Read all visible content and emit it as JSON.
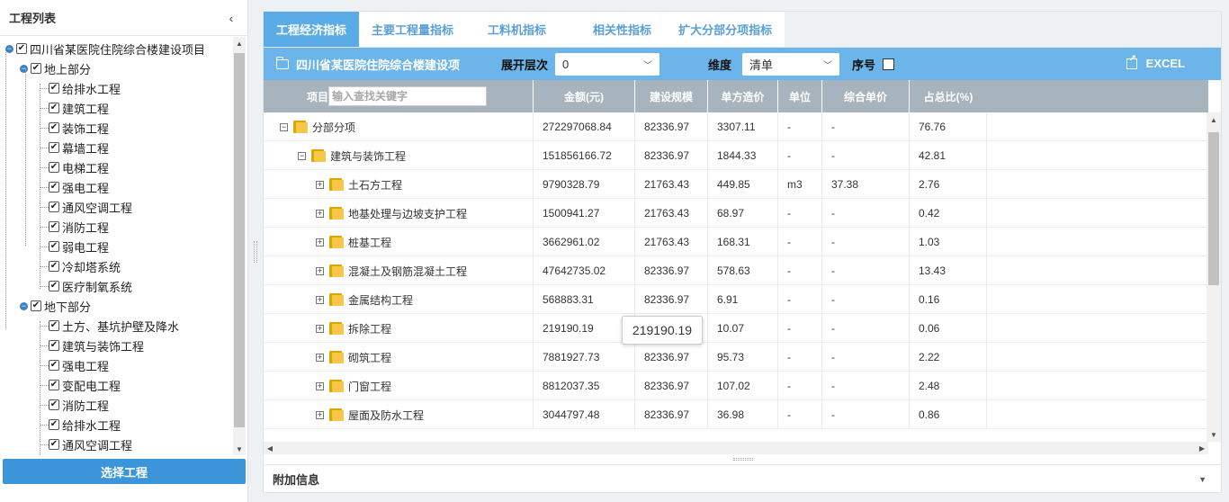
{
  "left": {
    "title": "工程列表",
    "select_button": "选择工程",
    "tree": [
      {
        "label": "四川省某医院住院综合楼建设项目",
        "level": 0,
        "toggle": "−"
      },
      {
        "label": "地上部分",
        "level": 1,
        "toggle": "−"
      },
      {
        "label": "给排水工程",
        "level": 2
      },
      {
        "label": "建筑工程",
        "level": 2
      },
      {
        "label": "装饰工程",
        "level": 2
      },
      {
        "label": "幕墙工程",
        "level": 2
      },
      {
        "label": "电梯工程",
        "level": 2
      },
      {
        "label": "强电工程",
        "level": 2
      },
      {
        "label": "通风空调工程",
        "level": 2
      },
      {
        "label": "消防工程",
        "level": 2
      },
      {
        "label": "弱电工程",
        "level": 2
      },
      {
        "label": "冷却塔系统",
        "level": 2
      },
      {
        "label": "医疗制氧系统",
        "level": 2
      },
      {
        "label": "地下部分",
        "level": 1,
        "toggle": "−"
      },
      {
        "label": "土方、基坑护壁及降水",
        "level": 2
      },
      {
        "label": "建筑与装饰工程",
        "level": 2
      },
      {
        "label": "强电工程",
        "level": 2
      },
      {
        "label": "变配电工程",
        "level": 2
      },
      {
        "label": "消防工程",
        "level": 2
      },
      {
        "label": "给排水工程",
        "level": 2
      },
      {
        "label": "通风空调工程",
        "level": 2
      }
    ]
  },
  "tabs": [
    {
      "label": "工程经济指标",
      "active": true
    },
    {
      "label": "主要工程量指标",
      "active": false
    },
    {
      "label": "工料机指标",
      "active": false
    },
    {
      "label": "相关性指标",
      "active": false
    },
    {
      "label": "扩大分部分项指标",
      "active": false
    }
  ],
  "toolbar": {
    "project_name": "四川省某医院住院综合楼建设项",
    "expand_label": "展开层次",
    "expand_value": "0",
    "dimension_label": "维度",
    "dimension_value": "清单",
    "index_label": "序号",
    "excel_label": "EXCEL"
  },
  "grid": {
    "columns": [
      "项目",
      "金额(元)",
      "建设规模",
      "单方造价",
      "单位",
      "综合单价",
      "占总比(%)"
    ],
    "search_placeholder": "输入查找关键字",
    "rows": [
      {
        "name": "分部分项",
        "depth": 0,
        "toggle": "−",
        "amount": "272297068.84",
        "scale": "82336.97",
        "unit_cost": "3307.11",
        "unit": "-",
        "comp_price": "-",
        "ratio": "76.76"
      },
      {
        "name": "建筑与装饰工程",
        "depth": 1,
        "toggle": "−",
        "amount": "151856166.72",
        "scale": "82336.97",
        "unit_cost": "1844.33",
        "unit": "-",
        "comp_price": "-",
        "ratio": "42.81"
      },
      {
        "name": "土石方工程",
        "depth": 2,
        "toggle": "+",
        "amount": "9790328.79",
        "scale": "21763.43",
        "unit_cost": "449.85",
        "unit": "m3",
        "comp_price": "37.38",
        "ratio": "2.76"
      },
      {
        "name": "地基处理与边坡支护工程",
        "depth": 2,
        "toggle": "+",
        "amount": "1500941.27",
        "scale": "21763.43",
        "unit_cost": "68.97",
        "unit": "-",
        "comp_price": "-",
        "ratio": "0.42"
      },
      {
        "name": "桩基工程",
        "depth": 2,
        "toggle": "+",
        "amount": "3662961.02",
        "scale": "21763.43",
        "unit_cost": "168.31",
        "unit": "-",
        "comp_price": "-",
        "ratio": "1.03"
      },
      {
        "name": "混凝土及钢筋混凝土工程",
        "depth": 2,
        "toggle": "+",
        "amount": "47642735.02",
        "scale": "82336.97",
        "unit_cost": "578.63",
        "unit": "-",
        "comp_price": "-",
        "ratio": "13.43"
      },
      {
        "name": "金属结构工程",
        "depth": 2,
        "toggle": "+",
        "amount": "568883.31",
        "scale": "82336.97",
        "unit_cost": "6.91",
        "unit": "-",
        "comp_price": "-",
        "ratio": "0.16"
      },
      {
        "name": "拆除工程",
        "depth": 2,
        "toggle": "+",
        "amount": "219190.19",
        "scale": "",
        "unit_cost": "10.07",
        "unit": "-",
        "comp_price": "-",
        "ratio": "0.06"
      },
      {
        "name": "砌筑工程",
        "depth": 2,
        "toggle": "+",
        "amount": "7881927.73",
        "scale": "82336.97",
        "unit_cost": "95.73",
        "unit": "-",
        "comp_price": "-",
        "ratio": "2.22"
      },
      {
        "name": "门窗工程",
        "depth": 2,
        "toggle": "+",
        "amount": "8812037.35",
        "scale": "82336.97",
        "unit_cost": "107.02",
        "unit": "-",
        "comp_price": "-",
        "ratio": "2.48"
      },
      {
        "name": "屋面及防水工程",
        "depth": 2,
        "toggle": "+",
        "amount": "3044797.48",
        "scale": "82336.97",
        "unit_cost": "36.98",
        "unit": "-",
        "comp_price": "-",
        "ratio": "0.86"
      }
    ],
    "tooltip": "219190.19"
  },
  "extra_label": "附加信息"
}
